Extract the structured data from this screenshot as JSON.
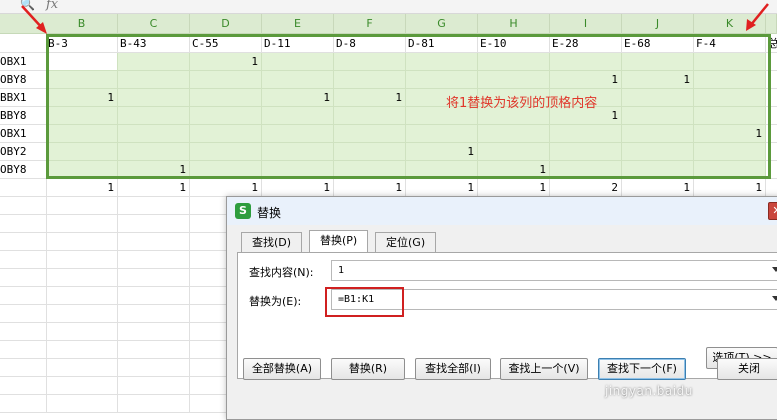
{
  "formula_bar": {
    "fx_label": "fx",
    "zoom_icon": "zoom-icon"
  },
  "columns": [
    "B",
    "C",
    "D",
    "E",
    "F",
    "G",
    "H",
    "I",
    "J",
    "K"
  ],
  "header_row": [
    "B-3",
    "B-43",
    "C-55",
    "D-11",
    "D-8",
    "D-81",
    "E-10",
    "E-28",
    "E-68",
    "F-4",
    "总"
  ],
  "row_labels": [
    "OBX1",
    "OBY8",
    "BBX1",
    "BBY8",
    "OBX1",
    "OBY2",
    "OBY8"
  ],
  "grid": [
    [
      "",
      "",
      "1",
      "",
      "",
      "",
      "",
      "",
      "",
      ""
    ],
    [
      "",
      "",
      "",
      "",
      "",
      "",
      "",
      "1",
      "1",
      ""
    ],
    [
      "1",
      "",
      "",
      "1",
      "1",
      "",
      "",
      "",
      "",
      ""
    ],
    [
      "",
      "",
      "",
      "",
      "",
      "",
      "",
      "1",
      "",
      ""
    ],
    [
      "",
      "",
      "",
      "",
      "",
      "",
      "",
      "",
      "",
      "1"
    ],
    [
      "",
      "",
      "",
      "",
      "",
      "1",
      "",
      "",
      "",
      ""
    ],
    [
      "",
      "1",
      "",
      "",
      "",
      "",
      "1",
      "",
      "",
      ""
    ]
  ],
  "totals": [
    "1",
    "1",
    "1",
    "1",
    "1",
    "1",
    "1",
    "2",
    "1",
    "1"
  ],
  "annotation": "将1替换为该列的顶格内容",
  "colors": {
    "selection_border": "#5b9a3c",
    "annotation": "#e0362a",
    "highlight_box": "#d02020",
    "arrow": "#e02020"
  },
  "dialog": {
    "title": "替换",
    "icon": "S",
    "tabs": [
      {
        "label": "查找(D)",
        "active": false
      },
      {
        "label": "替换(P)",
        "active": true
      },
      {
        "label": "定位(G)",
        "active": false
      }
    ],
    "find_label": "查找内容(N):",
    "find_value": "1",
    "replace_label": "替换为(E):",
    "replace_value": "=B1:K1",
    "options_button": "选项(T) >>",
    "buttons": [
      "全部替换(A)",
      "替换(R)",
      "查找全部(I)",
      "查找上一个(V)",
      "查找下一个(F)",
      "关闭"
    ]
  },
  "watermark": "jingyan.baidu"
}
